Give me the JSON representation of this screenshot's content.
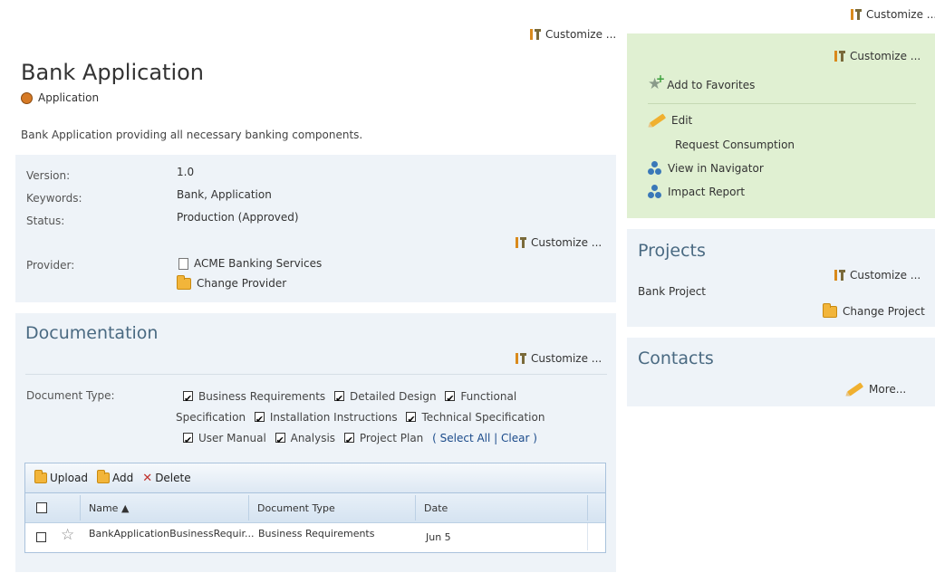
{
  "customize_label": "Customize ...",
  "header": {
    "title": "Bank Application",
    "type_label": "Application",
    "description": "Bank Application providing all necessary banking components."
  },
  "properties": {
    "version_label": "Version:",
    "version_value": "1.0",
    "keywords_label": "Keywords:",
    "keywords_value": "Bank, Application",
    "status_label": "Status:",
    "status_value": "Production (Approved)",
    "provider_label": "Provider:",
    "provider_value": "ACME Banking Services",
    "change_provider": "Change Provider"
  },
  "documentation": {
    "title": "Documentation",
    "doc_type_label": "Document Type:",
    "doc_types": [
      {
        "label": "Business Requirements",
        "checked": true
      },
      {
        "label": "Detailed Design",
        "checked": true
      },
      {
        "label": "Functional Specification",
        "checked": true
      },
      {
        "label": "Installation Instructions",
        "checked": true
      },
      {
        "label": "Technical Specification",
        "checked": true
      },
      {
        "label": "User Manual",
        "checked": true
      },
      {
        "label": "Analysis",
        "checked": true
      },
      {
        "label": "Project Plan",
        "checked": true
      }
    ],
    "select_all": "Select All",
    "clear": "Clear",
    "toolbar": {
      "upload": "Upload",
      "add": "Add",
      "delete": "Delete"
    },
    "columns": {
      "name": "Name ▲",
      "document_type": "Document Type",
      "date": "Date"
    },
    "rows": [
      {
        "name": "BankApplicationBusinessRequir...",
        "document_type": "Business Requirements",
        "date": "Jun 5"
      }
    ]
  },
  "actions": {
    "add_to_favorites": "Add to Favorites",
    "edit": "Edit",
    "request_consumption": "Request Consumption",
    "view_in_navigator": "View in Navigator",
    "impact_report": "Impact Report"
  },
  "projects": {
    "title": "Projects",
    "item": "Bank Project",
    "change_project": "Change Project"
  },
  "contacts": {
    "title": "Contacts",
    "more": "More..."
  }
}
